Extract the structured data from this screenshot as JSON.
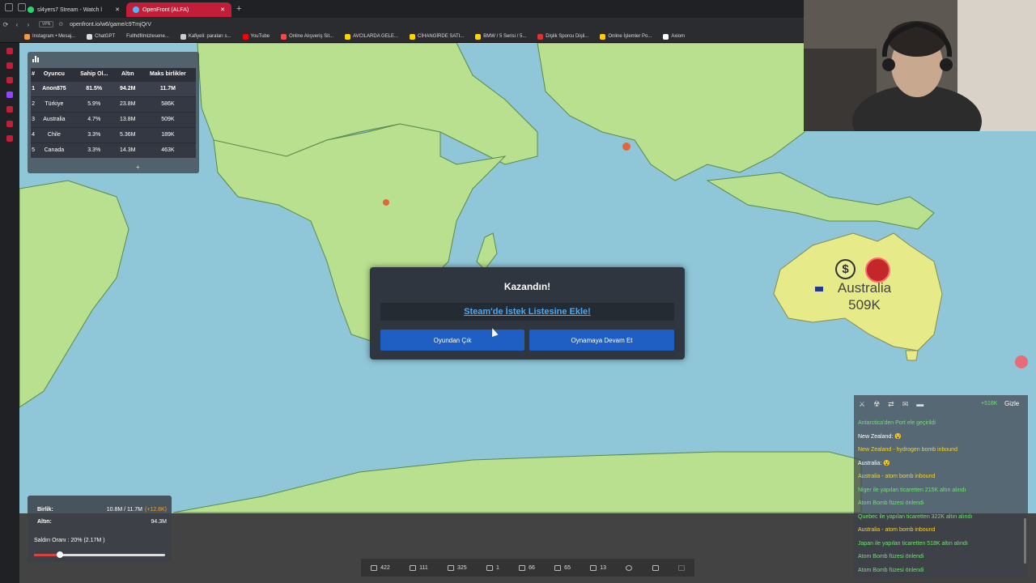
{
  "browser": {
    "tabs": [
      {
        "label": "sl4yers7 Stream - Watch l",
        "active": false
      },
      {
        "label": "OpenFront (ALFA)",
        "active": true
      }
    ],
    "url": "openfront.io/w6/game/c9TmjQrV",
    "vpn_label": "VPN",
    "bookmarks": [
      "Instagram • Mesaj...",
      "ChatGPT",
      "Fullhdfilmizlesene...",
      "Kafiyeli: paraları s...",
      "YouTube",
      "Online Alışveriş Sit...",
      "AVCILARDA GELE...",
      "CİHANGİRDE SATI...",
      "BMW / 5 Serisi / 5...",
      "Dişlik Sporcu Dişli...",
      "Online İşlemler Po...",
      "Axiom"
    ]
  },
  "leaderboard": {
    "headers": [
      "#",
      "Oyuncu",
      "Sahip Ol...",
      "Altın",
      "Maks birlikler"
    ],
    "rows": [
      [
        "1",
        "Anon875",
        "81.5%",
        "94.2M",
        "11.7M"
      ],
      [
        "2",
        "Türkiye",
        "5.9%",
        "23.8M",
        "586K"
      ],
      [
        "3",
        "Australia",
        "4.7%",
        "13.8M",
        "509K"
      ],
      [
        "4",
        "Chile",
        "3.3%",
        "5.36M",
        "189K"
      ],
      [
        "5",
        "Canada",
        "3.3%",
        "14.3M",
        "463K"
      ]
    ],
    "expand": "+"
  },
  "modal": {
    "title": "Kazandın!",
    "steam_link": "Steam'de İstek Listesine Ekle!",
    "quit_label": "Oyundan Çık",
    "continue_label": "Oynamaya Devam Et"
  },
  "map_label": {
    "name": "Australia",
    "troops": "509K",
    "dollar_icon": "$"
  },
  "events": {
    "gold_delta": "+518K",
    "hide_label": "Gizle",
    "lines": [
      {
        "text": "Antarctica'den Port ele geçirildi",
        "color": "green"
      },
      {
        "text": "New Zealand: 😵",
        "color": "white"
      },
      {
        "text": "New Zealand - hydrogen bomb inbound",
        "color": "yellow"
      },
      {
        "text": "Australia: 😵",
        "color": "white"
      },
      {
        "text": "Australia - atom bomb inbound",
        "color": "yellow"
      },
      {
        "text": "Niger ile yapılan ticaretten 215K altın alındı",
        "color": "green"
      },
      {
        "text": "Atom Bomb füzesi önlendi",
        "color": "green"
      },
      {
        "text": "Quebec ile yapılan ticaretten 322K altın alındı",
        "color": "green"
      },
      {
        "text": "Australia - atom bomb inbound",
        "color": "yellow"
      },
      {
        "text": "Japan ile yapılan ticaretten 518K altın alındı",
        "color": "green"
      },
      {
        "text": "Atom Bomb füzesi önlendi",
        "color": "green"
      },
      {
        "text": "Atom Bomb füzesi önlendi",
        "color": "green"
      }
    ]
  },
  "stats": {
    "troops_label": "Birlik:",
    "troops_value": "10.8M / 11.7M",
    "troops_delta": "(+12.8K)",
    "gold_label": "Altın:",
    "gold_value": "94.3M",
    "attack_label": "Saldırı Oranı : 20% (2.17M )",
    "attack_ratio": 0.2
  },
  "counters": [
    {
      "icon": "city-icon",
      "value": "422"
    },
    {
      "icon": "factory-icon",
      "value": "111"
    },
    {
      "icon": "anchor-icon",
      "value": "325"
    },
    {
      "icon": "shield-icon",
      "value": "1"
    },
    {
      "icon": "missile-icon",
      "value": "66"
    },
    {
      "icon": "sam-icon",
      "value": "65"
    },
    {
      "icon": "ship-icon",
      "value": "13"
    },
    {
      "icon": "nuke-icon",
      "value": ""
    },
    {
      "icon": "hydrogen-icon",
      "value": ""
    },
    {
      "icon": "mirv-icon",
      "value": ""
    }
  ],
  "colors": {
    "ocean": "#8fc6d8",
    "land_player": "#b8e08e",
    "australia": "#e6ea88",
    "button_blue": "#1f5fc4",
    "link_blue": "#4ea7ef"
  }
}
